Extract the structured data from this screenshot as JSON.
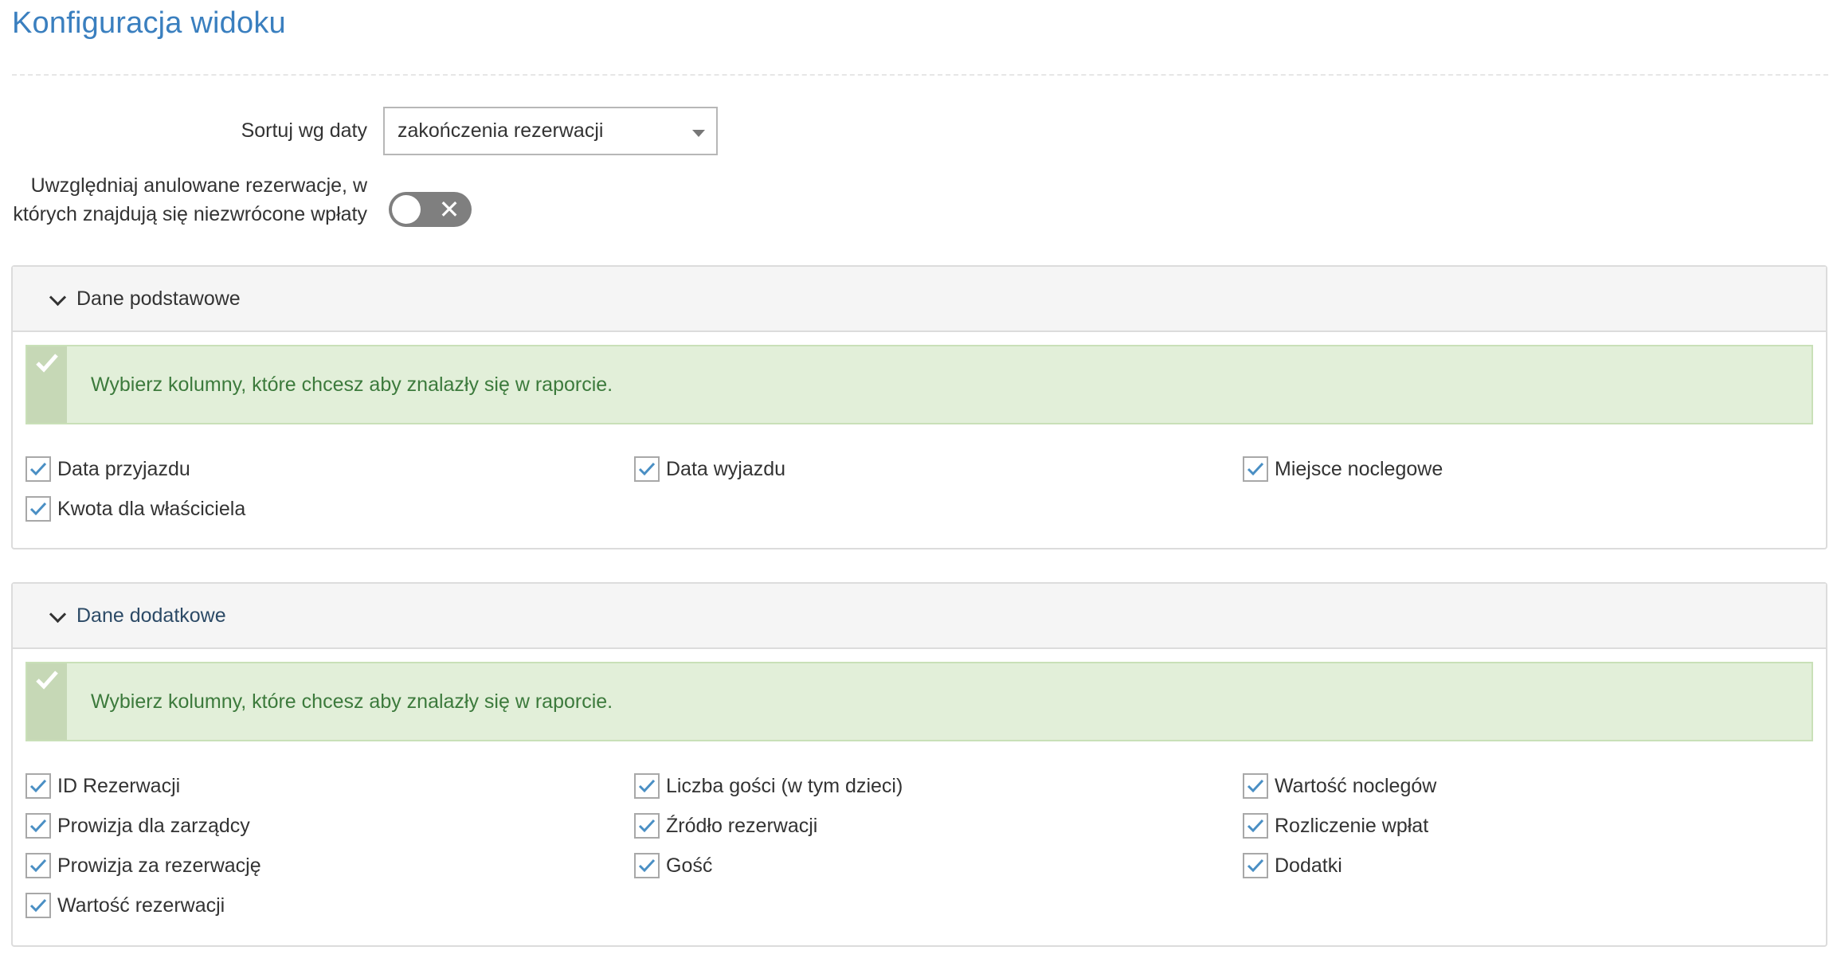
{
  "page": {
    "title": "Konfiguracja widoku"
  },
  "sort": {
    "label": "Sortuj wg daty",
    "selected": "zakończenia rezerwacji"
  },
  "cancelled": {
    "label": "Uwzględniaj anulowane rezerwacje, w których znajdują się niezwrócone wpłaty",
    "enabled": false
  },
  "sections": [
    {
      "title": "Dane podstawowe",
      "expanded": true,
      "info": "Wybierz kolumny, które chcesz aby znalazły się w raporcie.",
      "columns": [
        {
          "label": "Data przyjazdu",
          "checked": true
        },
        {
          "label": "Data wyjazdu",
          "checked": true
        },
        {
          "label": "Miejsce noclegowe",
          "checked": true
        },
        {
          "label": "Kwota dla właściciela",
          "checked": true
        }
      ]
    },
    {
      "title": "Dane dodatkowe",
      "expanded": true,
      "info": "Wybierz kolumny, które chcesz aby znalazły się w raporcie.",
      "columns": [
        {
          "label": "ID Rezerwacji",
          "checked": true
        },
        {
          "label": "Liczba gości (w tym dzieci)",
          "checked": true
        },
        {
          "label": "Wartość noclegów",
          "checked": true
        },
        {
          "label": "Prowizja dla zarządcy",
          "checked": true
        },
        {
          "label": "Źródło rezerwacji",
          "checked": true
        },
        {
          "label": "Rozliczenie wpłat",
          "checked": true
        },
        {
          "label": "Prowizja za rezerwację",
          "checked": true
        },
        {
          "label": "Gość",
          "checked": true
        },
        {
          "label": "Dodatki",
          "checked": true
        },
        {
          "label": "Wartość rezerwacji",
          "checked": true
        }
      ]
    }
  ],
  "colors": {
    "title": "#3a7fbf",
    "checkmark": "#4a8fc4",
    "alert_bg": "#e2efd9",
    "alert_text": "#3c7a3c",
    "toggle_off": "#7f7f7f"
  }
}
